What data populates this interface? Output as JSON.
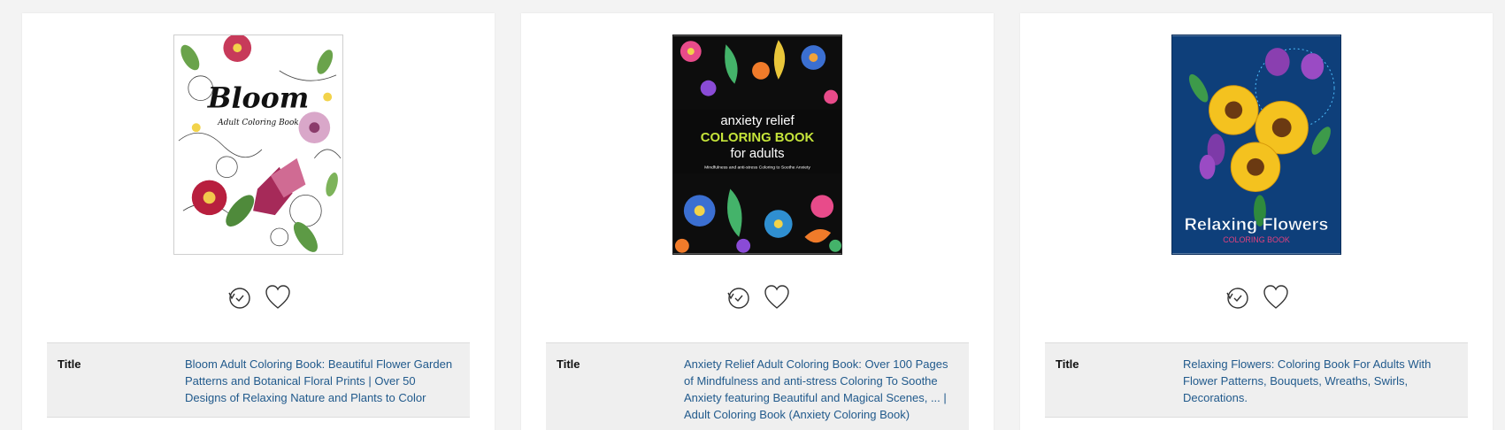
{
  "products": [
    {
      "cover": {
        "title": "Bloom",
        "subtitle": "Adult Coloring Book"
      },
      "title_label": "Title",
      "title_value": "Bloom Adult Coloring Book: Beautiful Flower Garden Patterns and Botanical Floral Prints | Over 50 Designs of Relaxing Nature and Plants to Color"
    },
    {
      "cover": {
        "line1": "anxiety relief",
        "line2": "COLORING BOOK",
        "line3": "for adults",
        "tagline": "Mindfulness and anti-stress Coloring to Soothe Anxiety"
      },
      "title_label": "Title",
      "title_value": "Anxiety Relief Adult Coloring Book: Over 100 Pages of Mindfulness and anti-stress Coloring To Soothe Anxiety featuring Beautiful and Magical Scenes, ... | Adult Coloring Book (Anxiety Coloring Book)"
    },
    {
      "cover": {
        "title": "Relaxing Flowers",
        "subtitle": "COLORING BOOK"
      },
      "title_label": "Title",
      "title_value": "Relaxing Flowers: Coloring Book For Adults With Flower Patterns, Bouquets, Wreaths, Swirls, Decorations."
    }
  ],
  "icons": {
    "history": "history-clock-icon",
    "favorite": "heart-icon"
  },
  "colors": {
    "link": "#215a8c",
    "row_background": "#efefef",
    "page_background": "#f3f3f3"
  }
}
